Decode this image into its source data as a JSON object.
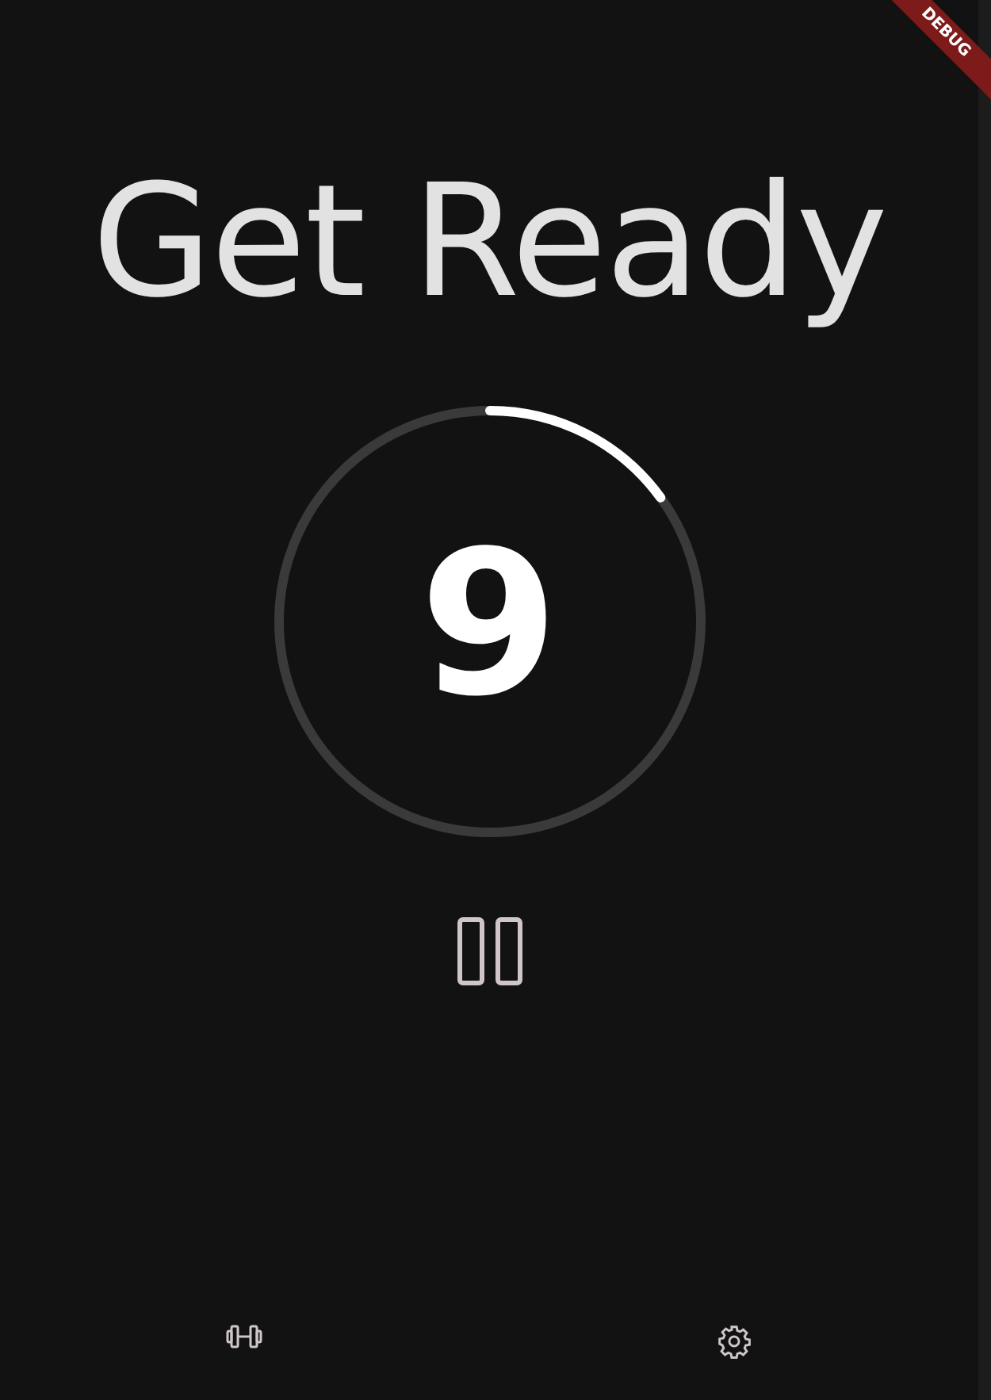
{
  "title": "Get Ready",
  "timer": {
    "count": "9",
    "level": 0.15
  },
  "debug_banner": "DEBUG",
  "bottom_nav": [
    {
      "kind": "workouts"
    },
    {
      "kind": "settings"
    }
  ]
}
